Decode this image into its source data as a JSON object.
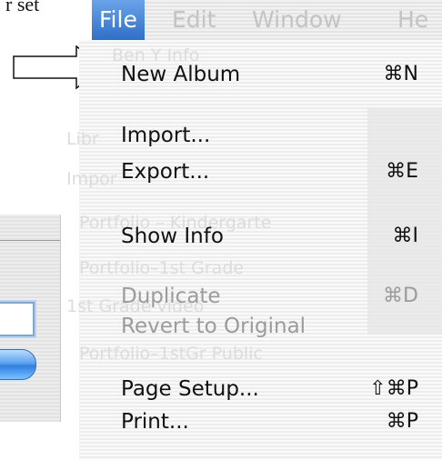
{
  "document": {
    "partial_text": "r set"
  },
  "menubar": {
    "titles": [
      "File",
      "Edit",
      "Window",
      "He"
    ]
  },
  "background_text": [
    "Ben Y Info",
    "Libr",
    "Impor",
    "Portfolio – Kindergarte",
    "Portfolio–1st Grade",
    "1st Grade video",
    "Portfolio–1stGr Public"
  ],
  "file_menu": {
    "items": [
      {
        "label": "New Album",
        "shortcut": "⌘N",
        "enabled": true
      },
      {
        "label": "Import...",
        "shortcut": "",
        "enabled": true
      },
      {
        "label": "Export...",
        "shortcut": "⌘E",
        "enabled": true
      },
      {
        "label": "Show Info",
        "shortcut": "⌘I",
        "enabled": true
      },
      {
        "label": "Duplicate",
        "shortcut": "⌘D",
        "enabled": false
      },
      {
        "label": "Revert to Original",
        "shortcut": "",
        "enabled": false
      },
      {
        "label": "Page Setup...",
        "shortcut": "⇧⌘P",
        "enabled": true
      },
      {
        "label": "Print...",
        "shortcut": "⌘P",
        "enabled": true
      }
    ]
  }
}
